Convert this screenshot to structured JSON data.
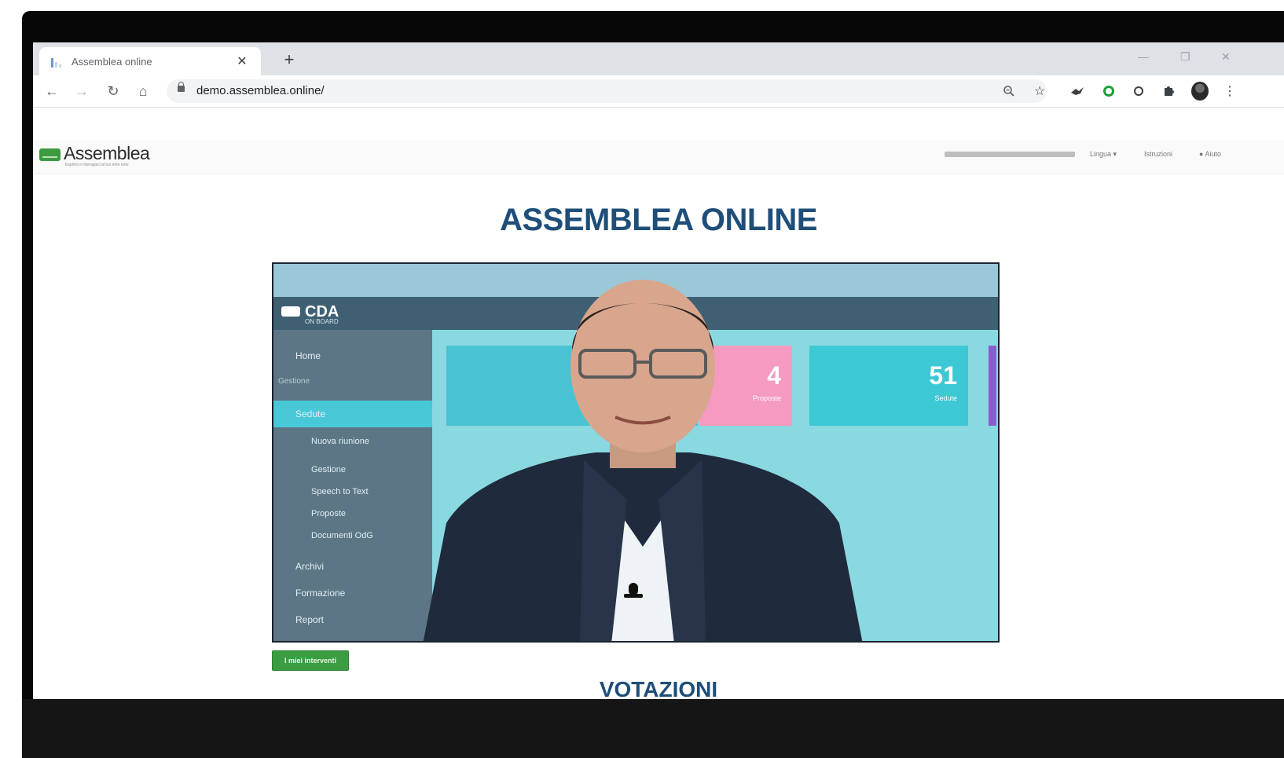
{
  "browser": {
    "tab_title": "Assemblea online",
    "tab_close": "✕",
    "new_tab": "+",
    "url": "demo.assemblea.online/"
  },
  "site": {
    "brand_name": "Assemblea",
    "brand_tagline": "Esprimi e interagisci al tuo ente ente",
    "nav": {
      "lingua": "Lingua ▾",
      "istruzioni": "Istruzioni",
      "aiuto": "Aiuto"
    },
    "title": "ASSEMBLEA ONLINE",
    "interventi_button": "I miei interventi",
    "section_title": "VOTAZIONI"
  },
  "video": {
    "app_logo": "CDA",
    "app_logo_sub": "ON BOARD",
    "sidebar_items": [
      "Home",
      "Gestione",
      "Sedute",
      "Nuova riunione",
      "Gestione",
      "Speech to Text",
      "Proposte",
      "Documenti OdG",
      "Archivi",
      "Formazione",
      "Report"
    ],
    "card_values": [
      "4",
      "51"
    ],
    "card_labels": [
      "Proposte",
      "Sedute"
    ]
  },
  "colors": {
    "heading": "#1f4e79",
    "brand_green": "#3d9a3f",
    "button_green": "#3b9d41"
  }
}
